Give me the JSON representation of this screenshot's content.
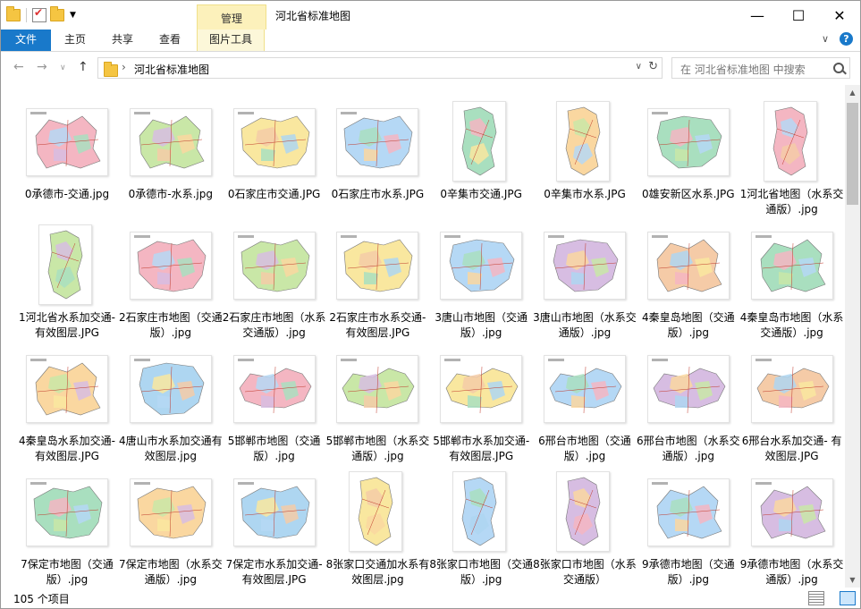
{
  "window": {
    "title": "河北省标准地图",
    "context_tab_group": "管理",
    "controls": {
      "minimize": "—",
      "maximize": "☐",
      "close": "✕"
    }
  },
  "ribbon": {
    "tabs": [
      {
        "label": "文件"
      },
      {
        "label": "主页"
      },
      {
        "label": "共享"
      },
      {
        "label": "查看"
      },
      {
        "label": "图片工具"
      }
    ]
  },
  "nav": {
    "breadcrumb": "河北省标准地图",
    "search_placeholder": "在 河北省标准地图 中搜索"
  },
  "files": [
    {
      "name": "0承德市-交通.jpg",
      "shape": "a"
    },
    {
      "name": "0承德市-水系.jpg",
      "shape": "a"
    },
    {
      "name": "0石家庄市交通.JPG",
      "shape": "b"
    },
    {
      "name": "0石家庄市水系.JPG",
      "shape": "b"
    },
    {
      "name": "0辛集市交通.JPG",
      "shape": "tall"
    },
    {
      "name": "0辛集市水系.JPG",
      "shape": "tall"
    },
    {
      "name": "0雄安新区水系.JPG",
      "shape": "c"
    },
    {
      "name": "1河北省地图（水系交通版）.jpg",
      "shape": "tall"
    },
    {
      "name": "1河北省水系加交通-有效图层.JPG",
      "shape": "tall"
    },
    {
      "name": "2石家庄市地图（交通版）.jpg",
      "shape": "b"
    },
    {
      "name": "2石家庄市地图（水系交通版）.jpg",
      "shape": "b"
    },
    {
      "name": "2石家庄市水系交通-有效图层.JPG",
      "shape": "b"
    },
    {
      "name": "3唐山市地图（交通版）.jpg",
      "shape": "c"
    },
    {
      "name": "3唐山市地图（水系交通版）.jpg",
      "shape": "c"
    },
    {
      "name": "4秦皇岛地图（交通版）.jpg",
      "shape": "a"
    },
    {
      "name": "4秦皇岛市地图（水系交通版）.jpg",
      "shape": "a"
    },
    {
      "name": "4秦皇岛水系加交通-有效图层.JPG",
      "shape": "a"
    },
    {
      "name": "4唐山市水系加交通有效图层.jpg",
      "shape": "c"
    },
    {
      "name": "5邯郸市地图（交通版）.jpg",
      "shape": "d"
    },
    {
      "name": "5邯郸市地图（水系交通版）.jpg",
      "shape": "d"
    },
    {
      "name": "5邯郸市水系加交通-有效图层.JPG",
      "shape": "d"
    },
    {
      "name": "6邢台市地图（交通版）.jpg",
      "shape": "d"
    },
    {
      "name": "6邢台市地图（水系交通版）.jpg",
      "shape": "d"
    },
    {
      "name": "6邢台水系加交通- 有效图层.JPG",
      "shape": "d"
    },
    {
      "name": "7保定市地图（交通版）.jpg",
      "shape": "b"
    },
    {
      "name": "7保定市地图（水系交通版）.jpg",
      "shape": "b"
    },
    {
      "name": "7保定市水系加交通-有效图层.JPG",
      "shape": "b"
    },
    {
      "name": "8张家口交通加水系有效图层.jpg",
      "shape": "tall"
    },
    {
      "name": "8张家口市地图（交通版）.jpg",
      "shape": "tall"
    },
    {
      "name": "8张家口市地图（水系交通版）",
      "shape": "tall"
    },
    {
      "name": "9承德市地图（交通版）.jpg",
      "shape": "a"
    },
    {
      "name": "9承德市地图（水系交通版）.jpg",
      "shape": "a"
    }
  ],
  "status": {
    "item_count": "105 个项目"
  }
}
